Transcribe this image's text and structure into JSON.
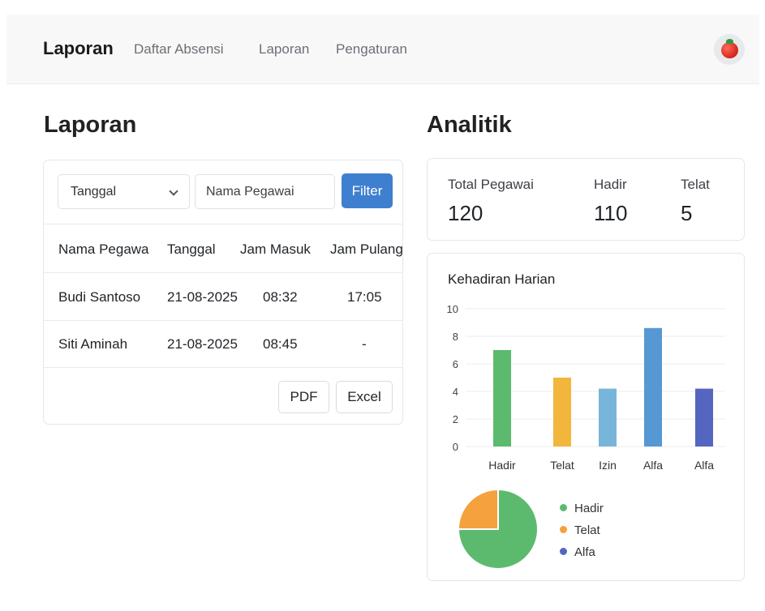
{
  "navbar": {
    "brand": "Laporan",
    "links": [
      "Daftar Absensi",
      "Laporan",
      "Pengaturan"
    ]
  },
  "report": {
    "title": "Laporan",
    "filter": {
      "select_value": "Tanggal",
      "name_placeholder": "Nama Pegawai",
      "filter_label": "Filter"
    },
    "table": {
      "headers": [
        "Nama Pegawa",
        "Tanggal",
        "Jam Masuk",
        "Jam Pulang"
      ],
      "rows": [
        [
          "Budi Santoso",
          "21-08-2025",
          "08:32",
          "17:05"
        ],
        [
          "Siti Aminah",
          "21-08-2025",
          "08:45",
          "-"
        ]
      ]
    },
    "export": {
      "pdf_label": "PDF",
      "excel_label": "Excel"
    }
  },
  "analytics": {
    "title": "Analitik",
    "stats": [
      {
        "label": "Total Pegawai",
        "value": "120"
      },
      {
        "label": "Hadir",
        "value": "110"
      },
      {
        "label": "Telat",
        "value": "5"
      }
    ]
  },
  "colors": {
    "primary": "#3f7fcf",
    "hadir": "#5cba6f",
    "telat": "#f2b63c",
    "izin": "#78b5da",
    "alfa": "#5598d3",
    "alfa2": "#5466bf",
    "pie_telat": "#f5a13d"
  },
  "chart_data": [
    {
      "type": "bar",
      "title": "Kehadiran Harian",
      "categories": [
        "Hadir",
        "Telat",
        "Izin",
        "Alfa",
        "Alfa"
      ],
      "values": [
        7,
        5,
        4.2,
        8.6,
        4.2
      ],
      "ylim": [
        0,
        10
      ],
      "yticks": [
        0,
        2,
        4,
        6,
        8,
        10
      ],
      "grid": true,
      "colors": [
        "#5cba6f",
        "#f2b63c",
        "#78b5da",
        "#5598d3",
        "#5466bf"
      ]
    },
    {
      "type": "pie",
      "labels": [
        "Hadir",
        "Telat",
        "Alfa"
      ],
      "values": [
        75,
        25,
        0
      ],
      "colors": [
        "#5cba6f",
        "#f5a13d",
        "#5466bf"
      ],
      "legend": "right"
    }
  ]
}
